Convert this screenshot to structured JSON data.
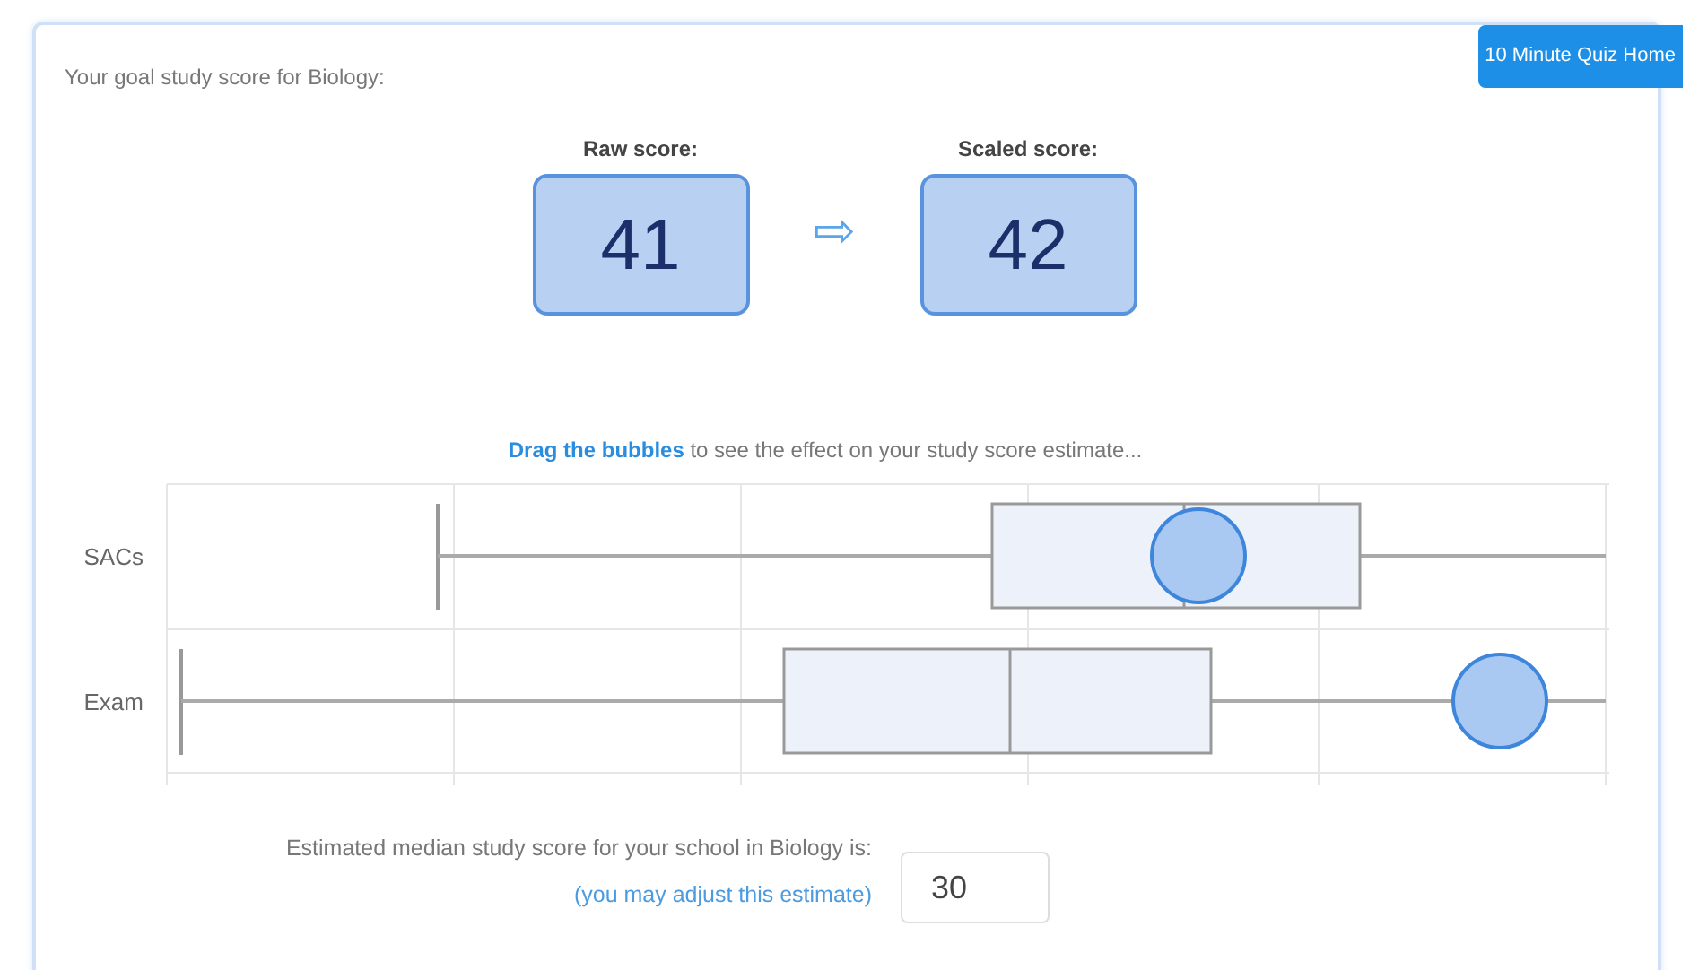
{
  "heading": "Your goal study score for Biology:",
  "home_button": "10 Minute Quiz Home",
  "scores": [
    {
      "label": "Raw score:",
      "value": "41"
    },
    {
      "label": "Scaled score:",
      "value": "42"
    }
  ],
  "arrow": "⇨",
  "instruction": "**Drag the bubbles** to see the effect on your study score estimate...",
  "chart_rows": [
    {
      "label": "SACs",
      "kind": "sacs"
    },
    {
      "label": "Exam",
      "kind": "exam"
    }
  ],
  "median_text": "Estimated median study score for your school in Biology is:",
  "adjust_link": "(you may adjust this estimate)",
  "median_value": "30"
}
